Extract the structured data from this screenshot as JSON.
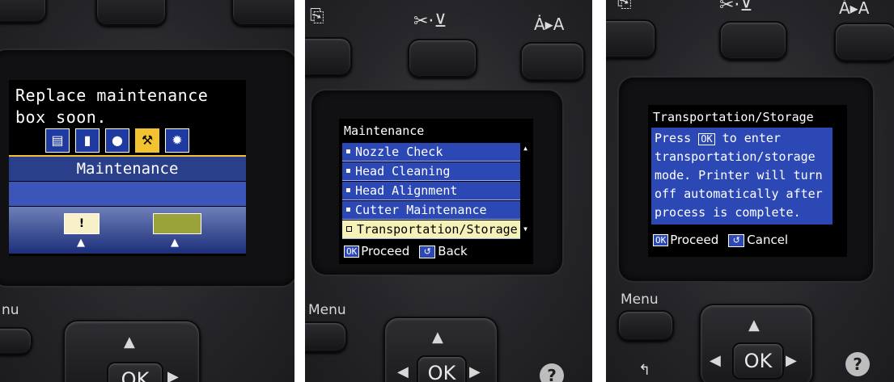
{
  "panel1": {
    "message_line1": "Replace maintenance",
    "message_line2": "box soon.",
    "tabs": [
      {
        "icon": "document-icon",
        "glyph": "▤"
      },
      {
        "icon": "paper-roll-icon",
        "glyph": "▮"
      },
      {
        "icon": "ink-drop-icon",
        "glyph": "●"
      },
      {
        "icon": "maintenance-tools-icon",
        "glyph": "⚒"
      },
      {
        "icon": "gear-icon",
        "glyph": "✹"
      }
    ],
    "title": "Maintenance",
    "warning_glyph": "!",
    "button_label_menu": "nu"
  },
  "panel2": {
    "header": "Maintenance",
    "items": [
      {
        "label": "Nozzle Check"
      },
      {
        "label": "Head Cleaning"
      },
      {
        "label": "Head Alignment"
      },
      {
        "label": "Cutter Maintenance"
      },
      {
        "label": "Transportation/Storage"
      }
    ],
    "selected_index": 4,
    "ok_key": "OK",
    "proceed_label": "Proceed",
    "back_label": "Back",
    "menu_label": "Menu",
    "ok_button": "OK",
    "top_glyphs": {
      "cut_feed": "✂·⊻",
      "font": "Ȧ▸A"
    }
  },
  "panel3": {
    "header": "Transportation/Storage",
    "line1_pre": "Press",
    "line1_key": "OK",
    "line1_post": "to enter",
    "line2": "transportation/storage",
    "line3": "mode. Printer will turn",
    "line4": "off automatically after",
    "line5": "process is complete.",
    "ok_key": "OK",
    "proceed_label": "Proceed",
    "cancel_label": "Cancel",
    "menu_label": "Menu",
    "ok_button": "OK",
    "help_glyph": "?",
    "top_glyphs": {
      "cut_feed": "✂·⊻",
      "font": "Ȧ▸A"
    }
  }
}
